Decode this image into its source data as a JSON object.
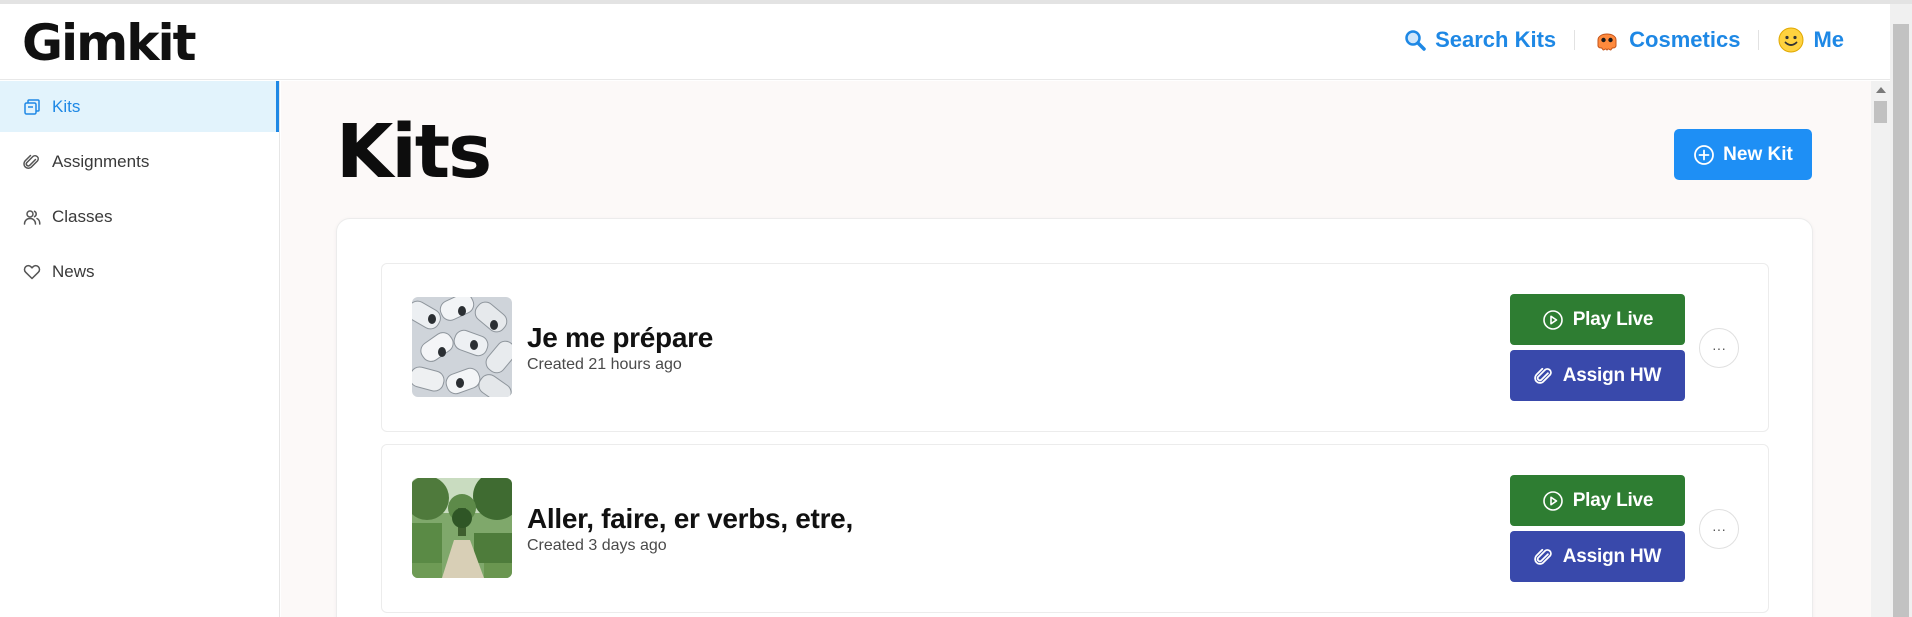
{
  "header": {
    "logo": "Gimkit",
    "nav": [
      {
        "label": "Search Kits",
        "icon": "magnifier-icon"
      },
      {
        "label": "Cosmetics",
        "icon": "octopus-icon"
      },
      {
        "label": "Me",
        "icon": "smiley-face-icon"
      }
    ]
  },
  "sidebar": {
    "items": [
      {
        "label": "Kits",
        "icon": "kits-icon",
        "active": true
      },
      {
        "label": "Assignments",
        "icon": "paperclip-icon",
        "active": false
      },
      {
        "label": "Classes",
        "icon": "people-icon",
        "active": false
      },
      {
        "label": "News",
        "icon": "heart-icon",
        "active": false
      }
    ]
  },
  "main": {
    "title": "Kits",
    "new_kit_label": "New Kit",
    "kits": [
      {
        "title": "Je me prépare",
        "created": "Created 21 hours ago",
        "thumbnail": "paper-rolls-photo",
        "play_label": "Play Live",
        "assign_label": "Assign HW",
        "more_label": "···"
      },
      {
        "title": "Aller, faire, er verbs, etre,",
        "created": "Created 3 days ago",
        "thumbnail": "garden-path-photo",
        "play_label": "Play Live",
        "assign_label": "Assign HW",
        "more_label": "···"
      }
    ]
  },
  "colors": {
    "accent": "#1e88e5",
    "play": "#2e7d32",
    "assign": "#3949ab",
    "new_kit": "#1e8ff5",
    "sidebar_active_bg": "#e2f3fc"
  }
}
